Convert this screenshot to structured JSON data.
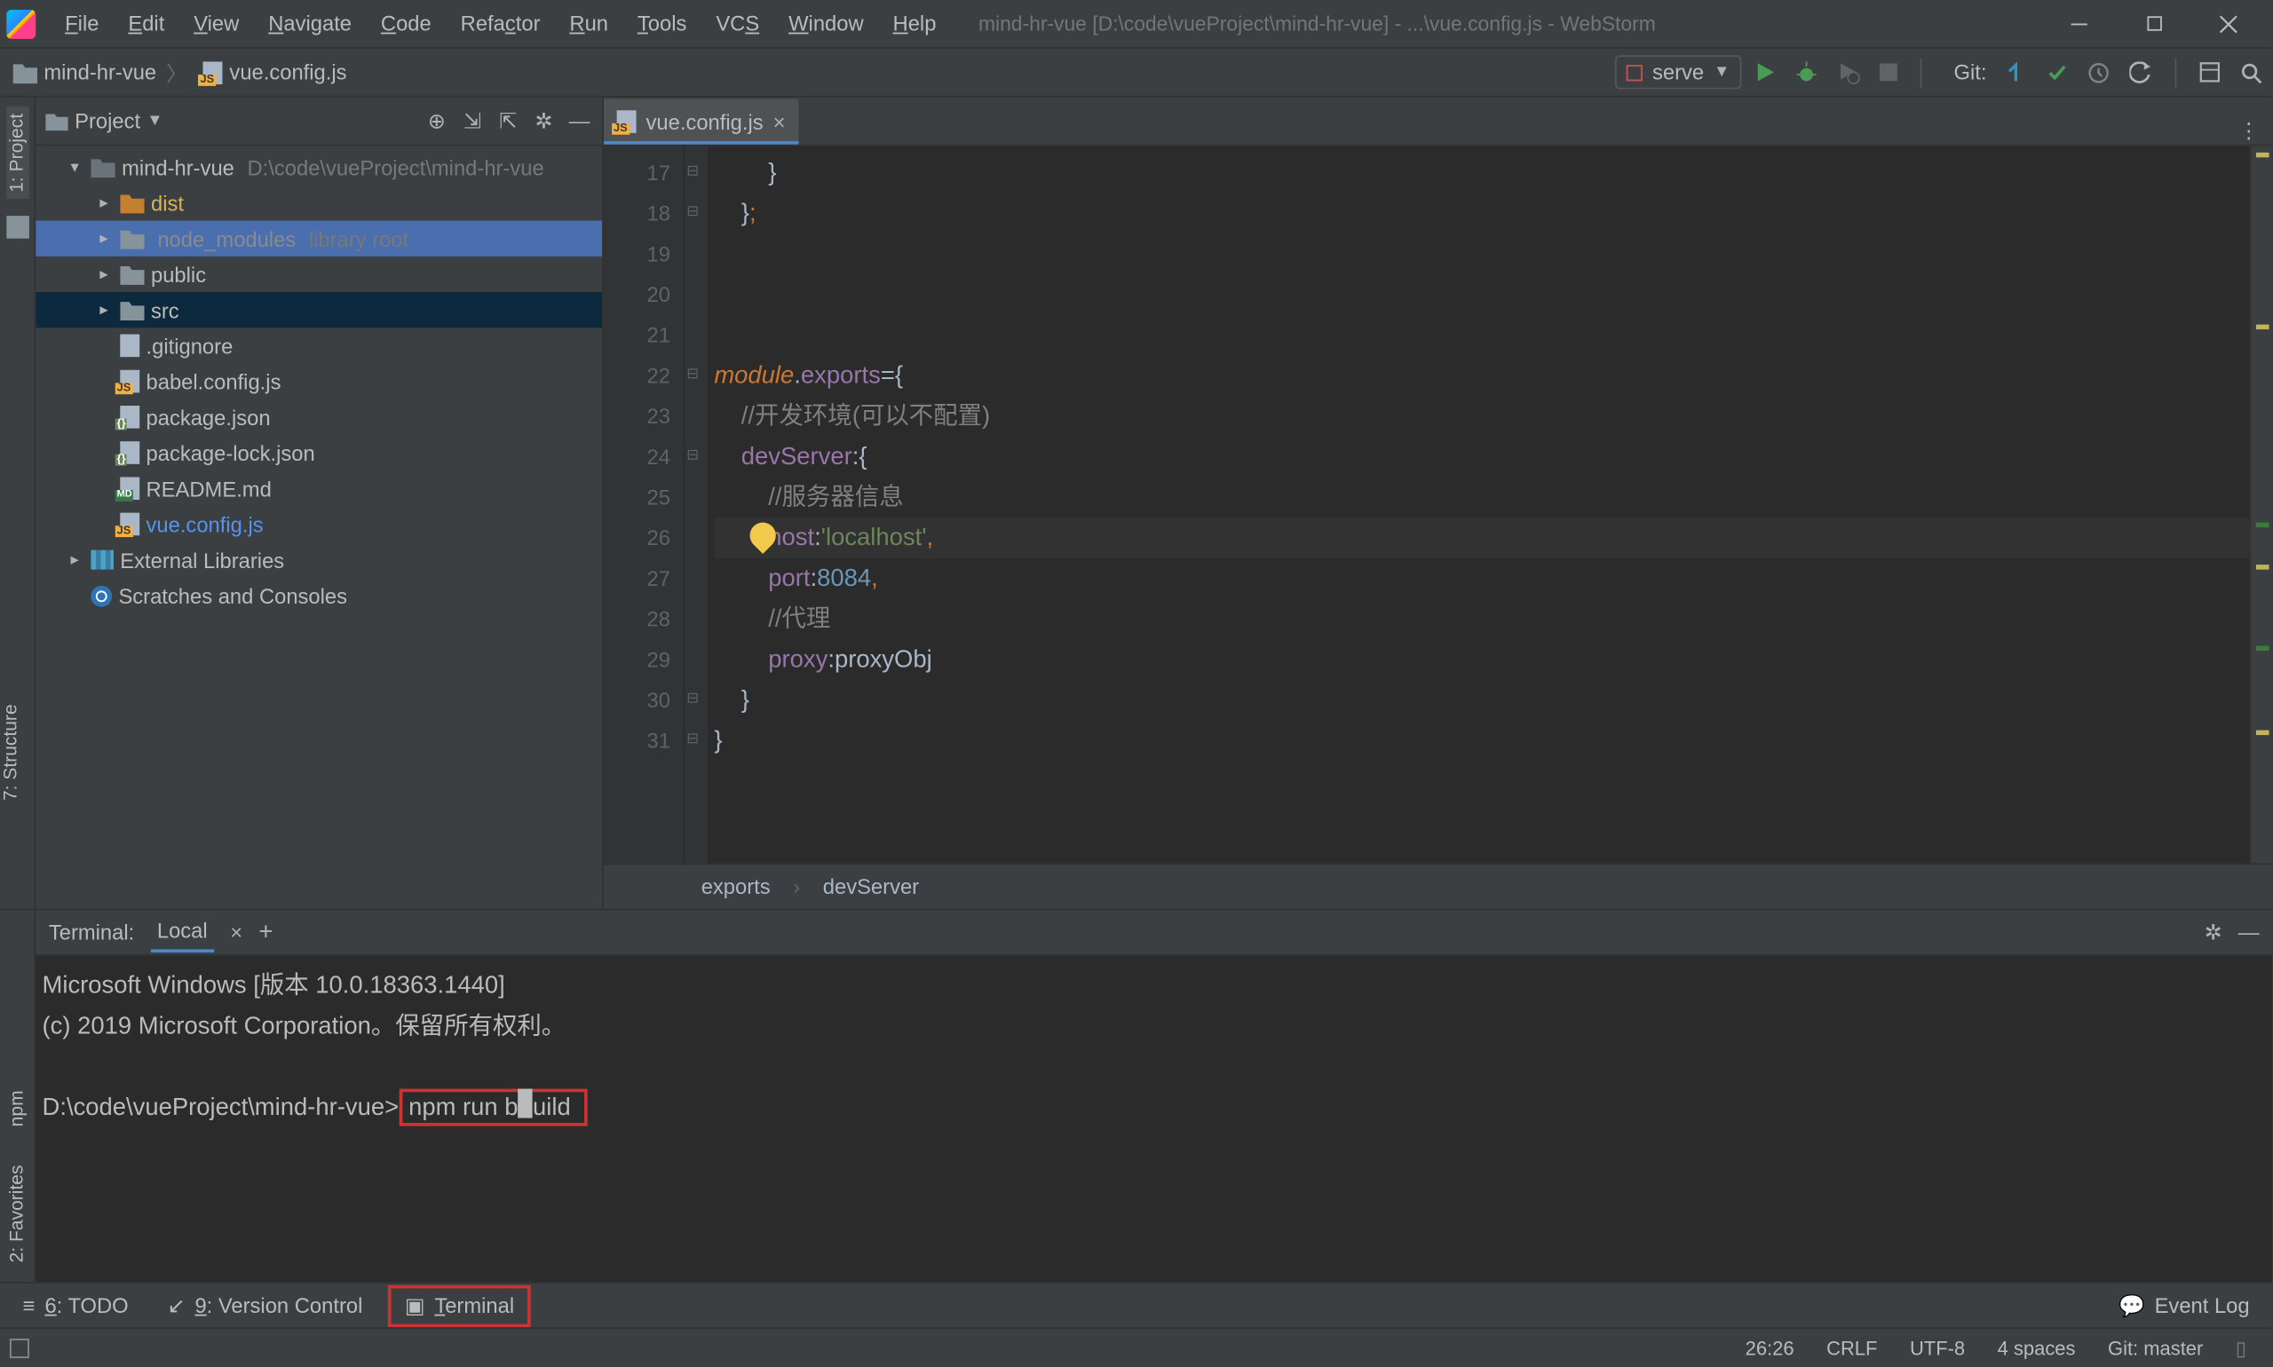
{
  "app_title": "mind-hr-vue [D:\\code\\vueProject\\mind-hr-vue] - ...\\vue.config.js - WebStorm",
  "menu": [
    "File",
    "Edit",
    "View",
    "Navigate",
    "Code",
    "Refactor",
    "Run",
    "Tools",
    "VCS",
    "Window",
    "Help"
  ],
  "menu_underline_idx": [
    0,
    0,
    0,
    0,
    0,
    4,
    0,
    0,
    2,
    0,
    0
  ],
  "crumbs": {
    "root": "mind-hr-vue",
    "file": "vue.config.js"
  },
  "run_config": "serve",
  "git_label": "Git:",
  "project_tool": {
    "title": "Project"
  },
  "tree": [
    {
      "depth": 0,
      "twist": "▾",
      "icon": "folder module",
      "text": "mind-hr-vue",
      "dim": "D:\\code\\vueProject\\mind-hr-vue",
      "sel": false
    },
    {
      "depth": 1,
      "twist": "▸",
      "icon": "folder orange",
      "text": "dist",
      "sel": false,
      "highlight": true
    },
    {
      "depth": 1,
      "twist": "▸",
      "icon": "folder",
      "text": "node_modules",
      "dim": "library root",
      "sel": true,
      "dimtext": true
    },
    {
      "depth": 1,
      "twist": "▸",
      "icon": "folder",
      "text": "public",
      "sel": false
    },
    {
      "depth": 1,
      "twist": "▸",
      "icon": "folder",
      "text": "src",
      "sel": false,
      "row_sel": true
    },
    {
      "depth": 1,
      "twist": "",
      "icon": "anyfile",
      "text": ".gitignore"
    },
    {
      "depth": 1,
      "twist": "",
      "icon": "jsfile",
      "text": "babel.config.js"
    },
    {
      "depth": 1,
      "twist": "",
      "icon": "json",
      "text": "package.json"
    },
    {
      "depth": 1,
      "twist": "",
      "icon": "json",
      "text": "package-lock.json"
    },
    {
      "depth": 1,
      "twist": "",
      "icon": "md",
      "text": "README.md"
    },
    {
      "depth": 1,
      "twist": "",
      "icon": "jsfile",
      "text": "vue.config.js",
      "link": true
    },
    {
      "depth": 0,
      "twist": "▸",
      "icon": "lib",
      "text": "External Libraries"
    },
    {
      "depth": 0,
      "twist": "",
      "icon": "scratch",
      "text": "Scratches and Consoles"
    }
  ],
  "editor_tab": "vue.config.js",
  "gutter_start": 17,
  "gutter_end": 31,
  "code_lines": [
    {
      "n": 17,
      "html": "        <span class='gray'>}</span>"
    },
    {
      "n": 18,
      "html": "    <span class='gray'>}</span><span class='punc'>;</span>"
    },
    {
      "n": 19,
      "html": ""
    },
    {
      "n": 20,
      "html": ""
    },
    {
      "n": 21,
      "html": ""
    },
    {
      "n": 22,
      "html": "<span class='kw'>module</span><span class='gray'>.</span><span class='prop'>exports</span><span class='gray'>=</span><span class='gray'>{</span>"
    },
    {
      "n": 23,
      "html": "    <span class='cmt'>//开发环境(可以不配置)</span>"
    },
    {
      "n": 24,
      "html": "    <span class='prop'>devServer</span><span class='gray'>:</span><span class='gray'>{</span>"
    },
    {
      "n": 25,
      "html": "        <span class='cmt'>//服务器信息</span>"
    },
    {
      "n": 26,
      "html": "        <span class='prop'>host</span><span class='gray'>:</span><span class='string'>'localhost'</span><span class='punc'>,</span>",
      "current": true,
      "bulb": true
    },
    {
      "n": 27,
      "html": "        <span class='prop'>port</span><span class='gray'>:</span><span class='num'>8084</span><span class='punc'>,</span>"
    },
    {
      "n": 28,
      "html": "        <span class='cmt'>//代理</span>"
    },
    {
      "n": 29,
      "html": "        <span class='prop'>proxy</span><span class='gray'>:</span><span class='gray'>proxyObj</span>"
    },
    {
      "n": 30,
      "html": "    <span class='gray'>}</span>"
    },
    {
      "n": 31,
      "html": "<span class='gray'>}</span>"
    }
  ],
  "fold_marks": [
    17,
    18,
    22,
    24,
    30,
    31
  ],
  "editor_breadcrumb": [
    "exports",
    "devServer"
  ],
  "terminal": {
    "title": "Terminal:",
    "tab": "Local",
    "lines": [
      "Microsoft Windows [版本 10.0.18363.1440]",
      "(c) 2019 Microsoft Corporation。保留所有权利。",
      ""
    ],
    "prompt": "D:\\code\\vueProject\\mind-hr-vue>",
    "cmd": "npm run build"
  },
  "left_tabs_top": [
    "1: Project"
  ],
  "left_tabs_editor": [
    "7: Structure"
  ],
  "left_tabs_term": [
    "npm",
    "2: Favorites"
  ],
  "bottom_tools": [
    {
      "icon": "≡",
      "label": "6: TODO",
      "ul": 0
    },
    {
      "icon": "↙",
      "label": "9: Version Control",
      "ul": 0
    },
    {
      "icon": "▣",
      "label": "Terminal",
      "boxed": true
    }
  ],
  "event_log": "Event Log",
  "status": {
    "pos": "26:26",
    "le": "CRLF",
    "enc": "UTF-8",
    "indent": "4 spaces",
    "branch": "Git: master"
  }
}
